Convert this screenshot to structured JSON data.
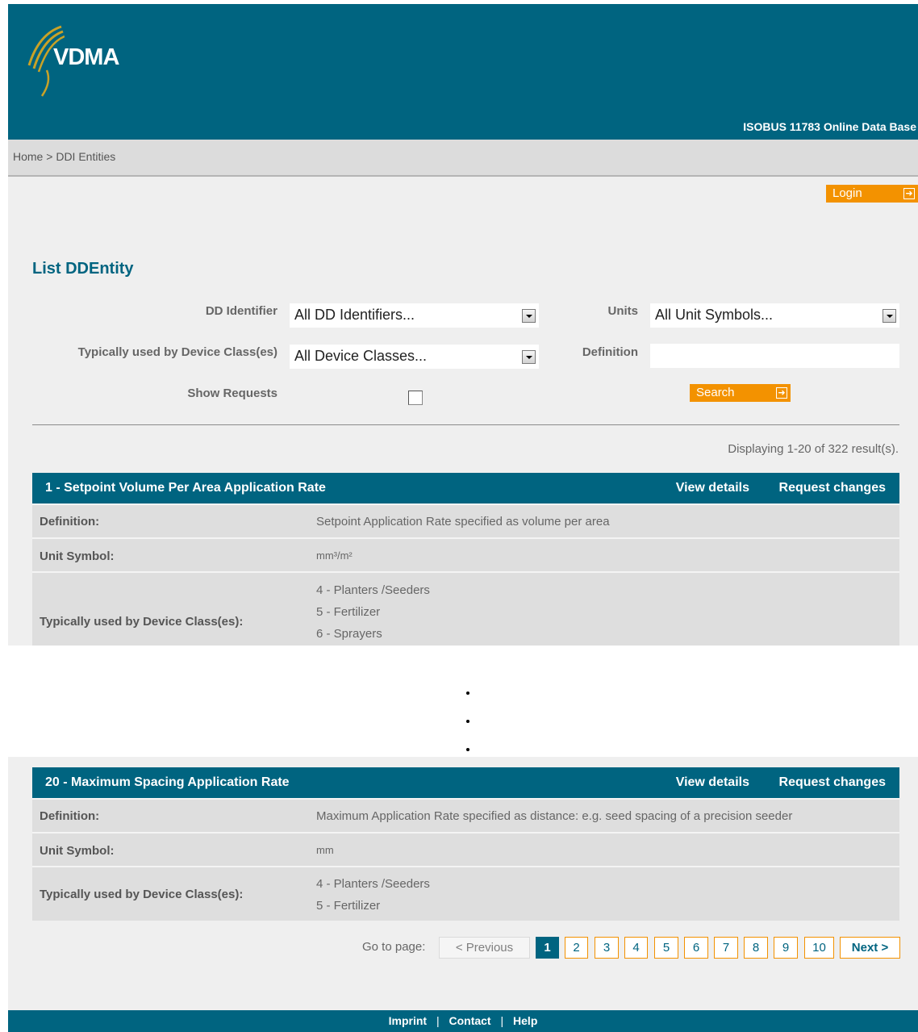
{
  "header": {
    "logo_text": "VDMA",
    "site_title": "ISOBUS 11783 Online Data Base"
  },
  "breadcrumb": {
    "home": "Home",
    "separator": ">",
    "current": "DDI Entities"
  },
  "login": {
    "label": "Login"
  },
  "page_title": "List DDEntity",
  "filters": {
    "dd_identifier": {
      "label": "DD Identifier",
      "value": "All DD Identifiers..."
    },
    "units": {
      "label": "Units",
      "value": "All Unit Symbols..."
    },
    "device_class": {
      "label": "Typically used by Device Class(es)",
      "value": "All Device Classes..."
    },
    "definition": {
      "label": "Definition",
      "value": ""
    },
    "show_requests": {
      "label": "Show Requests",
      "checked": false
    },
    "search_label": "Search"
  },
  "result_count": "Displaying 1-20 of 322 result(s).",
  "record_labels": {
    "view_details": "View details",
    "request_changes": "Request changes",
    "definition": "Definition:",
    "unit_symbol": "Unit Symbol:",
    "device_classes": "Typically used by Device Class(es):"
  },
  "records": [
    {
      "title": "1 - Setpoint Volume Per Area Application Rate",
      "definition": "Setpoint Application Rate specified as volume per area",
      "unit": "mm³/m²",
      "device_classes": [
        "4 - Planters /Seeders",
        "5 - Fertilizer",
        "6 - Sprayers"
      ]
    },
    {
      "title": "20 - Maximum Spacing Application Rate",
      "definition": "Maximum Application Rate specified as distance: e.g. seed spacing of a precision seeder",
      "unit": "mm",
      "device_classes": [
        "4 - Planters /Seeders",
        "5 - Fertilizer"
      ]
    }
  ],
  "pagination": {
    "goto_label": "Go to page:",
    "previous": "< Previous",
    "pages": [
      "1",
      "2",
      "3",
      "4",
      "5",
      "6",
      "7",
      "8",
      "9",
      "10"
    ],
    "current": "1",
    "next": "Next >"
  },
  "footer": {
    "imprint": "Imprint",
    "contact": "Contact",
    "help": "Help",
    "separator": "|"
  },
  "colors": {
    "brand_teal": "#006480",
    "accent_orange": "#f39200",
    "logo_gold": "#c9a227"
  },
  "icons": {
    "logo": "vdma-swoosh-icon",
    "button_arrow": "arrow-right-box-icon",
    "dropdown": "dropdown-arrow-icon",
    "ellipsis": "vertical-ellipsis-icon"
  }
}
